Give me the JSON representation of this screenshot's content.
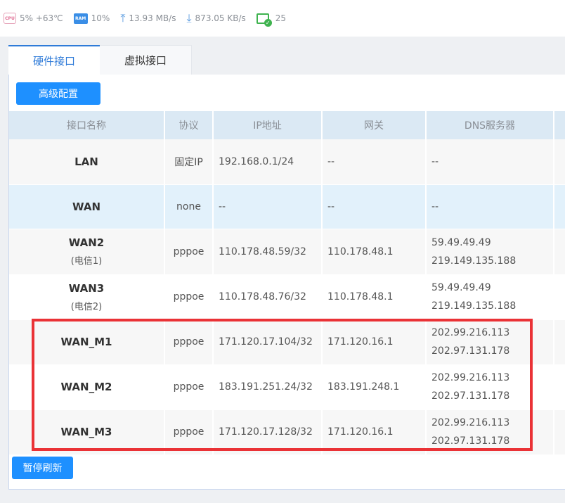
{
  "status": {
    "cpu": "5% +63℃",
    "cpu_icon_label": "CPU",
    "ram": "10%",
    "ram_icon_label": "RAM",
    "upload": "13.93 MB/s",
    "download": "873.05 KB/s",
    "connections": "25",
    "icons": [
      "cpu-icon",
      "ram-icon",
      "upload-arrow-icon",
      "download-arrow-icon",
      "monitor-check-icon"
    ]
  },
  "tabs": [
    {
      "label": "硬件接口",
      "active": true
    },
    {
      "label": "虚拟接口",
      "active": false
    }
  ],
  "buttons": {
    "advanced": "高级配置",
    "pause_refresh": "暂停刷新"
  },
  "table": {
    "headers": [
      "接口名称",
      "协议",
      "IP地址",
      "网关",
      "DNS服务器"
    ],
    "rows": [
      {
        "name": "LAN",
        "sub": "",
        "protocol": "固定IP",
        "ip": "192.168.0.1/24",
        "gateway": "--",
        "dns": [
          "--"
        ]
      },
      {
        "name": "WAN",
        "sub": "",
        "protocol": "none",
        "ip": "--",
        "gateway": "--",
        "dns": [
          "--"
        ]
      },
      {
        "name": "WAN2",
        "sub": "(电信1)",
        "protocol": "pppoe",
        "ip": "110.178.48.59/32",
        "gateway": "110.178.48.1",
        "dns": [
          "59.49.49.49",
          "219.149.135.188"
        ]
      },
      {
        "name": "WAN3",
        "sub": "(电信2)",
        "protocol": "pppoe",
        "ip": "110.178.48.76/32",
        "gateway": "110.178.48.1",
        "dns": [
          "59.49.49.49",
          "219.149.135.188"
        ]
      },
      {
        "name": "WAN_M1",
        "sub": "",
        "protocol": "pppoe",
        "ip": "171.120.17.104/32",
        "gateway": "171.120.16.1",
        "dns": [
          "202.99.216.113",
          "202.97.131.178"
        ]
      },
      {
        "name": "WAN_M2",
        "sub": "",
        "protocol": "pppoe",
        "ip": "183.191.251.24/32",
        "gateway": "183.191.248.1",
        "dns": [
          "202.99.216.113",
          "202.97.131.178"
        ]
      },
      {
        "name": "WAN_M3",
        "sub": "",
        "protocol": "pppoe",
        "ip": "171.120.17.128/32",
        "gateway": "171.120.16.1",
        "dns": [
          "202.99.216.113",
          "202.97.131.178"
        ]
      }
    ]
  },
  "colors": {
    "accent": "#1e90ff",
    "tab_active": "#2f7bd8",
    "header_bg": "#dbe9f4",
    "highlight_row": "#e2f1fb",
    "annotation_red": "#ea3236"
  }
}
